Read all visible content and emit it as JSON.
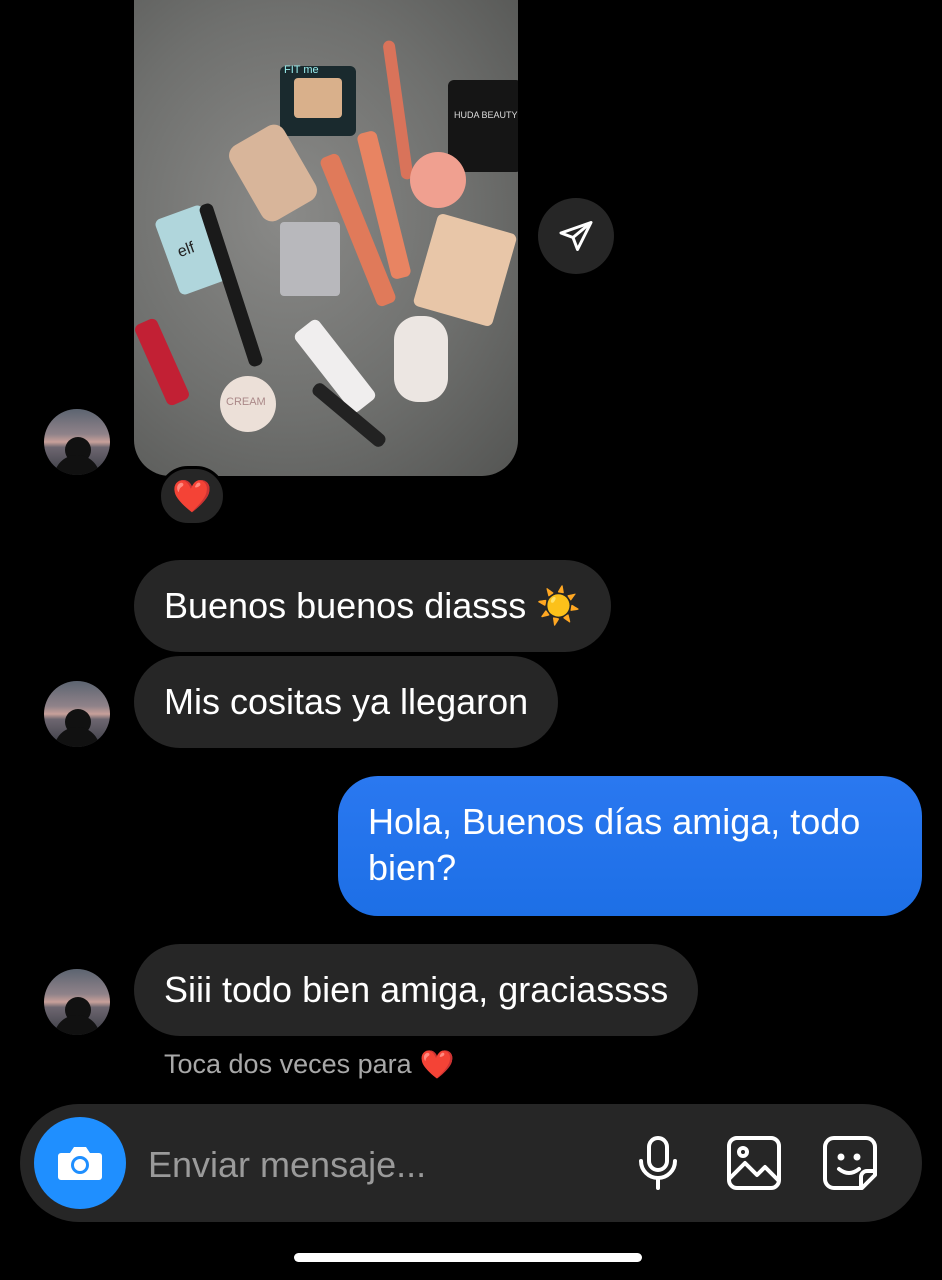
{
  "messages": [
    {
      "type": "photo",
      "from": "contact",
      "reaction": "❤️"
    },
    {
      "type": "text",
      "from": "contact",
      "text": "Buenos buenos diasss ☀️"
    },
    {
      "type": "text",
      "from": "contact",
      "text": "Mis cositas ya llegaron"
    },
    {
      "type": "text",
      "from": "me",
      "text": "Hola, Buenos días amiga, todo bien?"
    },
    {
      "type": "text",
      "from": "contact",
      "text": "Siii todo bien amiga, graciassss"
    }
  ],
  "hint": {
    "text": "Toca dos veces para",
    "emoji": "❤️"
  },
  "composer": {
    "placeholder": "Enviar mensaje...",
    "icons": [
      "camera-icon",
      "microphone-icon",
      "gallery-icon",
      "sticker-icon"
    ]
  },
  "photo_labels": {
    "fit": "FIT me",
    "huda": "HUDA BEAUTY",
    "elf": "elf",
    "cream": "CREAM"
  },
  "colors": {
    "sent_bubble": "#1f6feb",
    "received_bubble": "#262626",
    "camera_button": "#1f8fff",
    "background": "#000000"
  }
}
